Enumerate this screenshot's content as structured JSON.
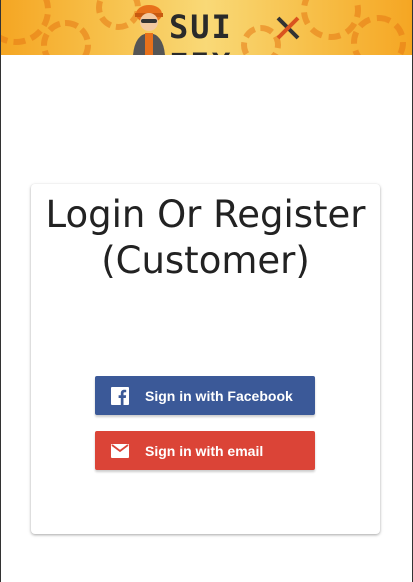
{
  "header": {
    "logo_text": "SUI FIX"
  },
  "card": {
    "title_line1": "Login Or Register",
    "title_line2": "(Customer)"
  },
  "buttons": {
    "facebook_label": "Sign in with Facebook",
    "email_label": "Sign in with email"
  },
  "colors": {
    "facebook": "#3b5998",
    "email": "#db4437",
    "header_accent": "#f5a623"
  },
  "icons": {
    "facebook": "facebook-icon",
    "email": "mail-icon",
    "logo": "mechanic-avatar-icon"
  }
}
